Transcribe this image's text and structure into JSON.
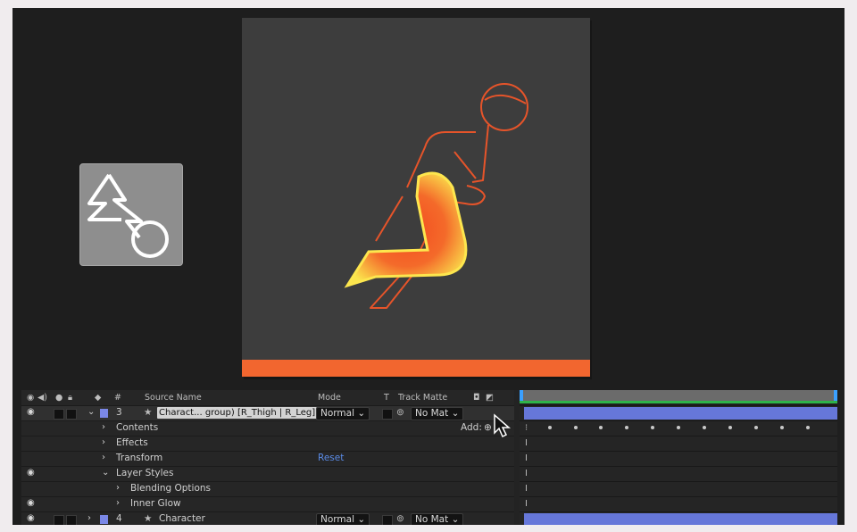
{
  "timeline": {
    "header": {
      "col_num": "#",
      "source_name": "Source Name",
      "mode": "Mode",
      "t": "T",
      "track_matte": "Track Matte"
    },
    "layers": [
      {
        "num": "3",
        "name": "Charact... group) [R_Thigh | R_Leg]",
        "mode": "Normal",
        "matte": "No Mat"
      },
      {
        "num": "4",
        "name": "Character",
        "mode": "Normal",
        "matte": "No Mat"
      }
    ],
    "properties": {
      "contents": "Contents",
      "add_label": "Add:",
      "effects": "Effects",
      "transform": "Transform",
      "reset": "Reset",
      "layer_styles": "Layer Styles",
      "blending_options": "Blending Options",
      "inner_glow": "Inner Glow"
    }
  },
  "colors": {
    "accent_orange": "#f2662f",
    "layer_label": "#7a87e6",
    "link_blue": "#5a8be6"
  },
  "icons": [
    "eye-icon",
    "audio-icon",
    "solo-icon",
    "lock-icon",
    "tag-icon",
    "star-icon",
    "chevron-icon",
    "add-icon",
    "cursor-icon",
    "shape-tool-icon"
  ]
}
